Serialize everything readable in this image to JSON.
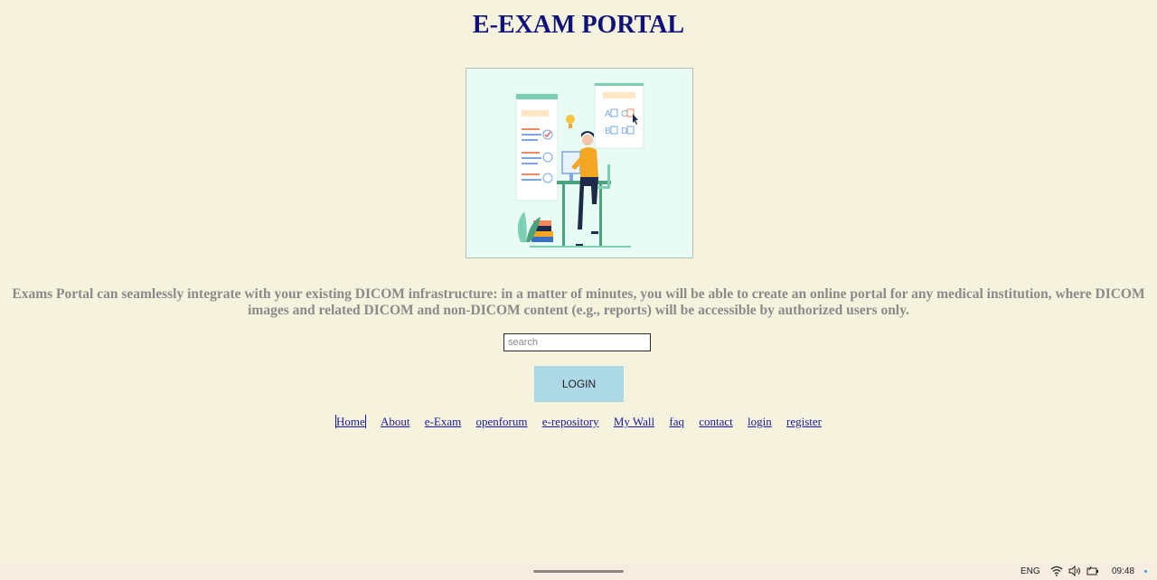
{
  "page": {
    "title": "E-EXAM PORTAL",
    "description": "Exams Portal can seamlessly integrate with your existing DICOM infrastructure: in a matter of minutes, you will be able to create an online portal for any medical institution, where DICOM images and related DICOM and non-DICOM content (e.g., reports) will be accessible by authorized users only."
  },
  "hero": {
    "card_left_text": "",
    "card_right_letters": [
      "A",
      "B",
      "C",
      "D"
    ]
  },
  "search": {
    "placeholder": "search",
    "value": ""
  },
  "login": {
    "label": "LOGIN"
  },
  "nav": {
    "items": [
      "Home",
      "About",
      "e-Exam",
      "openforum",
      "e-repository",
      "My Wall",
      "faq",
      "contact",
      "login",
      "register"
    ]
  },
  "taskbar": {
    "language": "ENG",
    "time": "09:48",
    "icons": [
      "wifi-icon",
      "volume-icon",
      "battery-icon"
    ]
  },
  "colors": {
    "background": "#f5f3dd",
    "title": "#10107a",
    "description": "#8a8a8a",
    "link": "#1a1aa6",
    "login_button": "#add8e6"
  }
}
